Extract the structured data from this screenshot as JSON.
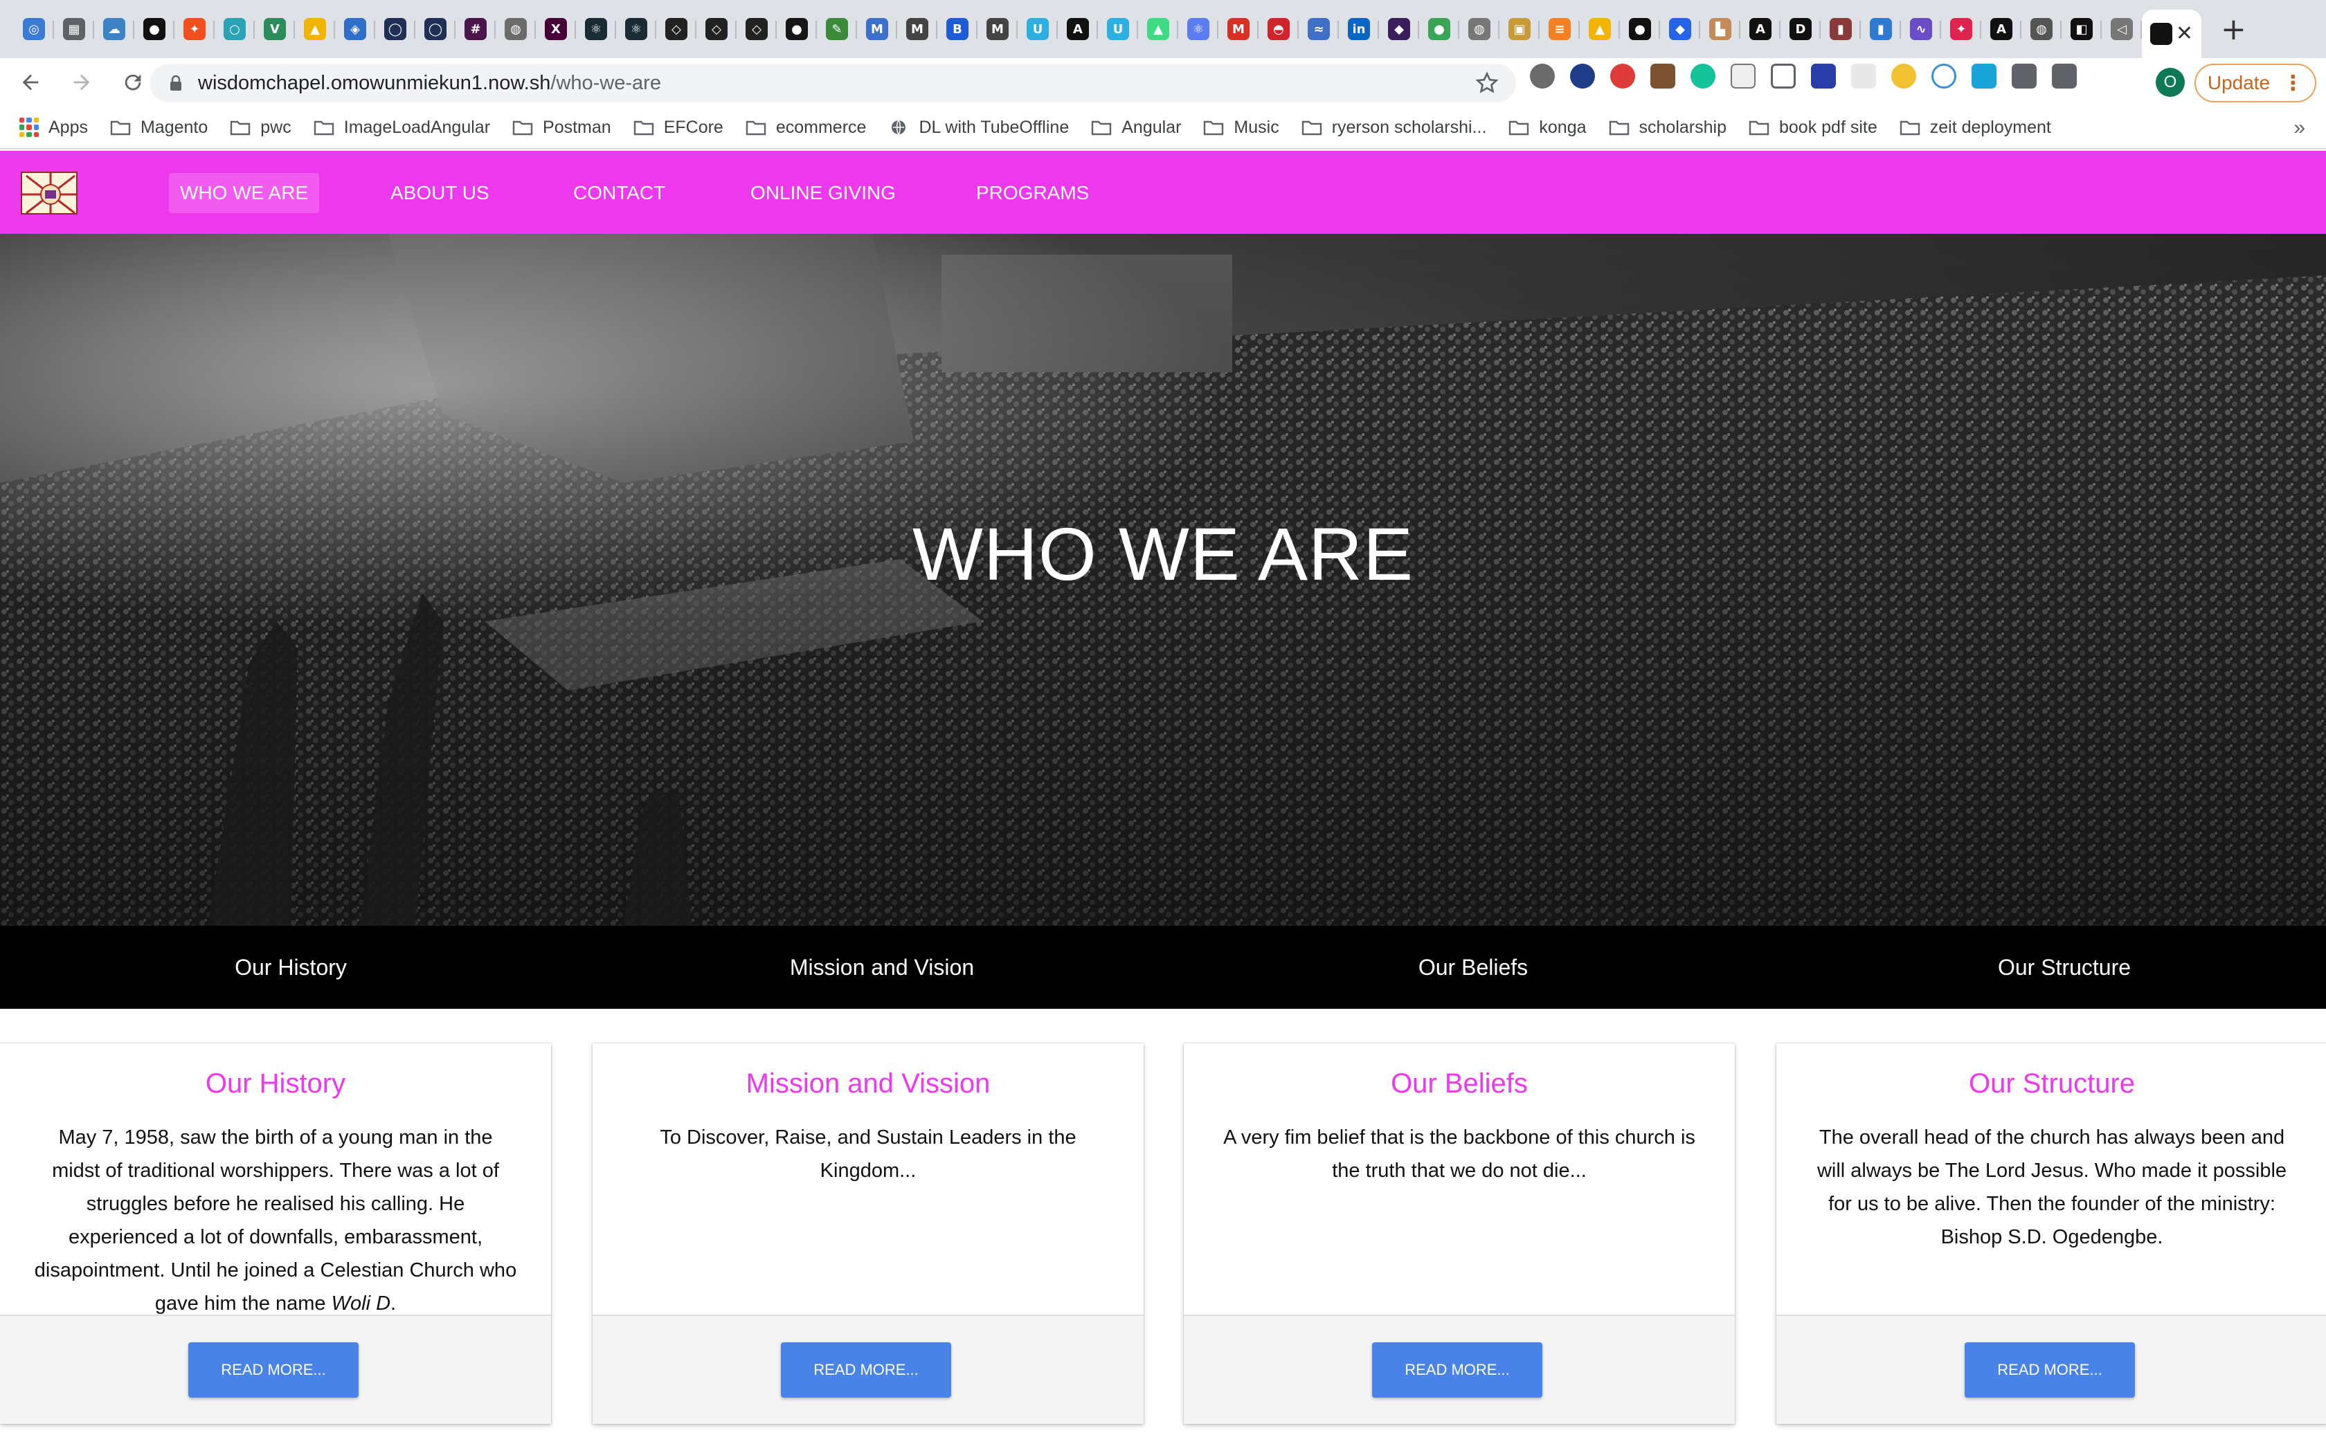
{
  "browser": {
    "url_host": "wisdomchapel.omowunmiekun1.now.sh",
    "url_path": "/who-we-are",
    "update_label": "Update",
    "profile_initial": "O",
    "tab_favicons": [
      {
        "name": "chrome-tab-icon",
        "color": "#3b7bd6",
        "glyph": "◎"
      },
      {
        "name": "grid-tab-icon",
        "color": "#5f6368",
        "glyph": "▦"
      },
      {
        "name": "cloud-tab-icon",
        "color": "#3d82c4",
        "glyph": "☁"
      },
      {
        "name": "medium-tab-icon",
        "color": "#111111",
        "glyph": "●"
      },
      {
        "name": "figma-tab-icon",
        "color": "#f24e1e",
        "glyph": "✦"
      },
      {
        "name": "circle-tab-icon",
        "color": "#29a3b5",
        "glyph": "○"
      },
      {
        "name": "vue-tab-icon",
        "color": "#2c8c5c",
        "glyph": "V"
      },
      {
        "name": "drive-tab-icon",
        "color": "#f2b400",
        "glyph": "▲"
      },
      {
        "name": "azure-tab-icon",
        "color": "#2f6fc9",
        "glyph": "◈"
      },
      {
        "name": "ring-tab-icon",
        "color": "#1f2f55",
        "glyph": "◯"
      },
      {
        "name": "ring-tab-icon-2",
        "color": "#1f2f55",
        "glyph": "◯"
      },
      {
        "name": "slack-tab-icon",
        "color": "#4a154b",
        "glyph": "#"
      },
      {
        "name": "globe-tab-icon",
        "color": "#6b6b6b",
        "glyph": "◍"
      },
      {
        "name": "xd-tab-icon",
        "color": "#470137",
        "glyph": "X"
      },
      {
        "name": "react-tab-icon",
        "color": "#1b2b34",
        "glyph": "⚛"
      },
      {
        "name": "react-tab-icon-2",
        "color": "#1b2b34",
        "glyph": "⚛"
      },
      {
        "name": "codepen-tab-icon",
        "color": "#222222",
        "glyph": "◇"
      },
      {
        "name": "codepen-tab-icon-2",
        "color": "#222222",
        "glyph": "◇"
      },
      {
        "name": "codepen-tab-icon-3",
        "color": "#222222",
        "glyph": "◇"
      },
      {
        "name": "github-tab-icon",
        "color": "#181717",
        "glyph": "●"
      },
      {
        "name": "leaf-tab-icon",
        "color": "#3a8a3a",
        "glyph": "✎"
      },
      {
        "name": "mdb-tab-icon",
        "color": "#3b71ca",
        "glyph": "M"
      },
      {
        "name": "mdx-tab-icon",
        "color": "#444444",
        "glyph": "M"
      },
      {
        "name": "bootstrap-tab-icon",
        "color": "#1f5bd6",
        "glyph": "B"
      },
      {
        "name": "mdx-tab-icon-2",
        "color": "#444444",
        "glyph": "M"
      },
      {
        "name": "udemy-tab-icon",
        "color": "#2bb0e0",
        "glyph": "U"
      },
      {
        "name": "angular-tab-icon",
        "color": "#111111",
        "glyph": "A"
      },
      {
        "name": "udemy-tab-icon-2",
        "color": "#2bb0e0",
        "glyph": "U"
      },
      {
        "name": "android-tab-icon",
        "color": "#3ddc84",
        "glyph": "▲"
      },
      {
        "name": "atom-tab-icon",
        "color": "#5c7df0",
        "glyph": "⚛"
      },
      {
        "name": "gmail-tab-icon",
        "color": "#d93025",
        "glyph": "M"
      },
      {
        "name": "bowl-tab-icon",
        "color": "#d2232a",
        "glyph": "◓"
      },
      {
        "name": "wave-tab-icon",
        "color": "#3f6fc6",
        "glyph": "≈"
      },
      {
        "name": "linkedin-tab-icon",
        "color": "#0a66c2",
        "glyph": "in"
      },
      {
        "name": "league-tab-icon",
        "color": "#3a1d5c",
        "glyph": "◆"
      },
      {
        "name": "badge-tab-icon",
        "color": "#3aa655",
        "glyph": "●"
      },
      {
        "name": "globe-tab-icon-2",
        "color": "#777777",
        "glyph": "◍"
      },
      {
        "name": "image-tab-icon",
        "color": "#c89a3a",
        "glyph": "▣"
      },
      {
        "name": "stack-tab-icon",
        "color": "#f48024",
        "glyph": "≡"
      },
      {
        "name": "drive-tab-icon-2",
        "color": "#f2b400",
        "glyph": "▲"
      },
      {
        "name": "medium-tab-icon-2",
        "color": "#111111",
        "glyph": "●"
      },
      {
        "name": "diamond-tab-icon",
        "color": "#2563eb",
        "glyph": "◆"
      },
      {
        "name": "figure-tab-icon",
        "color": "#c58a5a",
        "glyph": "▙"
      },
      {
        "name": "angular-tab-icon-2",
        "color": "#111111",
        "glyph": "A"
      },
      {
        "name": "d-tab-icon",
        "color": "#111111",
        "glyph": "D"
      },
      {
        "name": "book-tab-icon",
        "color": "#8b3a3a",
        "glyph": "▮"
      },
      {
        "name": "blue-tab-icon",
        "color": "#2e7ad1",
        "glyph": "▮"
      },
      {
        "name": "chart-tab-icon",
        "color": "#6a4cc7",
        "glyph": "∿"
      },
      {
        "name": "nest-tab-icon",
        "color": "#e0234e",
        "glyph": "✦"
      },
      {
        "name": "angular-tab-icon-3",
        "color": "#111111",
        "glyph": "A"
      },
      {
        "name": "globe-tab-icon-3",
        "color": "#555555",
        "glyph": "◍"
      },
      {
        "name": "bolt-tab-icon",
        "color": "#111111",
        "glyph": "◧"
      },
      {
        "name": "sound-tab-icon",
        "color": "#777777",
        "glyph": "◁"
      }
    ],
    "bookmarks": [
      {
        "label": "Apps",
        "kind": "apps"
      },
      {
        "label": "Magento",
        "kind": "folder"
      },
      {
        "label": "pwc",
        "kind": "folder"
      },
      {
        "label": "ImageLoadAngular",
        "kind": "folder"
      },
      {
        "label": "Postman",
        "kind": "folder"
      },
      {
        "label": "EFCore",
        "kind": "folder"
      },
      {
        "label": "ecommerce",
        "kind": "folder"
      },
      {
        "label": "DL with TubeOffline",
        "kind": "globe"
      },
      {
        "label": "Angular",
        "kind": "folder"
      },
      {
        "label": "Music",
        "kind": "folder"
      },
      {
        "label": "ryerson scholarshi...",
        "kind": "folder"
      },
      {
        "label": "konga",
        "kind": "folder"
      },
      {
        "label": "scholarship",
        "kind": "folder"
      },
      {
        "label": "book pdf site",
        "kind": "folder"
      },
      {
        "label": "zeit deployment",
        "kind": "folder"
      }
    ],
    "bookmarks_more": "»"
  },
  "site": {
    "brand_color": "#ee38ed",
    "accent_button_color": "#4a83e8",
    "nav": [
      {
        "label": "WHO WE ARE",
        "active": true
      },
      {
        "label": "ABOUT US",
        "active": false
      },
      {
        "label": "CONTACT",
        "active": false
      },
      {
        "label": "ONLINE GIVING",
        "active": false
      },
      {
        "label": "PROGRAMS",
        "active": false
      }
    ],
    "hero_title": "WHO WE ARE",
    "section_tabs": [
      "Our History",
      "Mission and Vision",
      "Our Beliefs",
      "Our Structure"
    ],
    "cards": [
      {
        "title": "Our History",
        "body": "May 7, 1958, saw the birth of a young man in the midst of traditional worshippers. There was a lot of struggles before he realised his calling. He experienced a lot of downfalls, embarassment, disapointment. Until he joined a Celestian Church who gave him the name ",
        "body_emphasis": "Woli D",
        "body_end": ".",
        "button": "READ MORE..."
      },
      {
        "title": "Mission and Vission",
        "body": "To Discover, Raise, and Sustain Leaders in the Kingdom...",
        "body_emphasis": "",
        "body_end": "",
        "button": "READ MORE..."
      },
      {
        "title": "Our Beliefs",
        "body": "A very fim belief that is the backbone of this church is the truth that we do not die...",
        "body_emphasis": "",
        "body_end": "",
        "button": "READ MORE..."
      },
      {
        "title": "Our Structure",
        "body": "The overall head of the church has always been and will always be The Lord Jesus. Who made it possible for us to be alive. Then the founder of the ministry: Bishop S.D. Ogedengbe.",
        "body_emphasis": "",
        "body_end": "",
        "button": "READ MORE..."
      }
    ]
  }
}
